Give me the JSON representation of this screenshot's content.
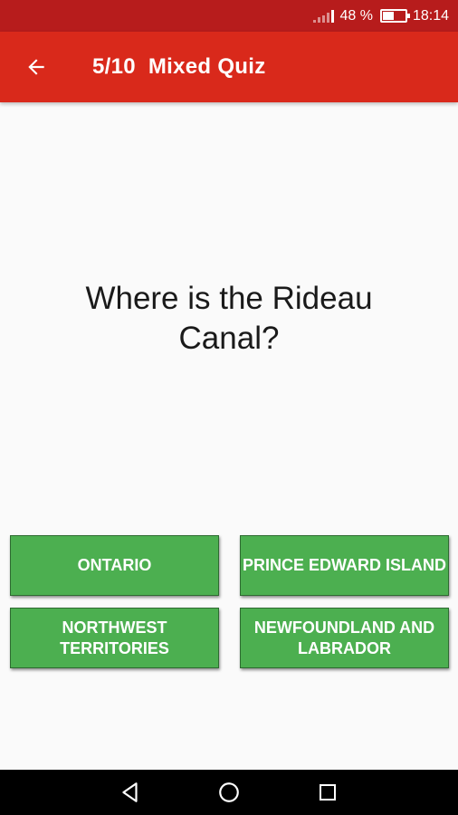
{
  "status_bar": {
    "battery_percent": "48 %",
    "time": "18:14",
    "signal_icon": "signal-icon",
    "battery_icon": "battery-icon"
  },
  "app_bar": {
    "back_icon": "arrow-left-icon",
    "title": "5/10  Mixed Quiz",
    "background": "#d9291b"
  },
  "question": {
    "text": "Where is the Rideau Canal?"
  },
  "answers": [
    {
      "label": "ONTARIO"
    },
    {
      "label": "PRINCE EDWARD ISLAND"
    },
    {
      "label": "NORTHWEST TERRITORIES"
    },
    {
      "label": "NEWFOUNDLAND AND LABRADOR"
    }
  ],
  "answer_color": "#4caf50",
  "nav_bar": {
    "back_icon": "triangle-back-icon",
    "home_icon": "circle-home-icon",
    "recents_icon": "square-recents-icon"
  }
}
